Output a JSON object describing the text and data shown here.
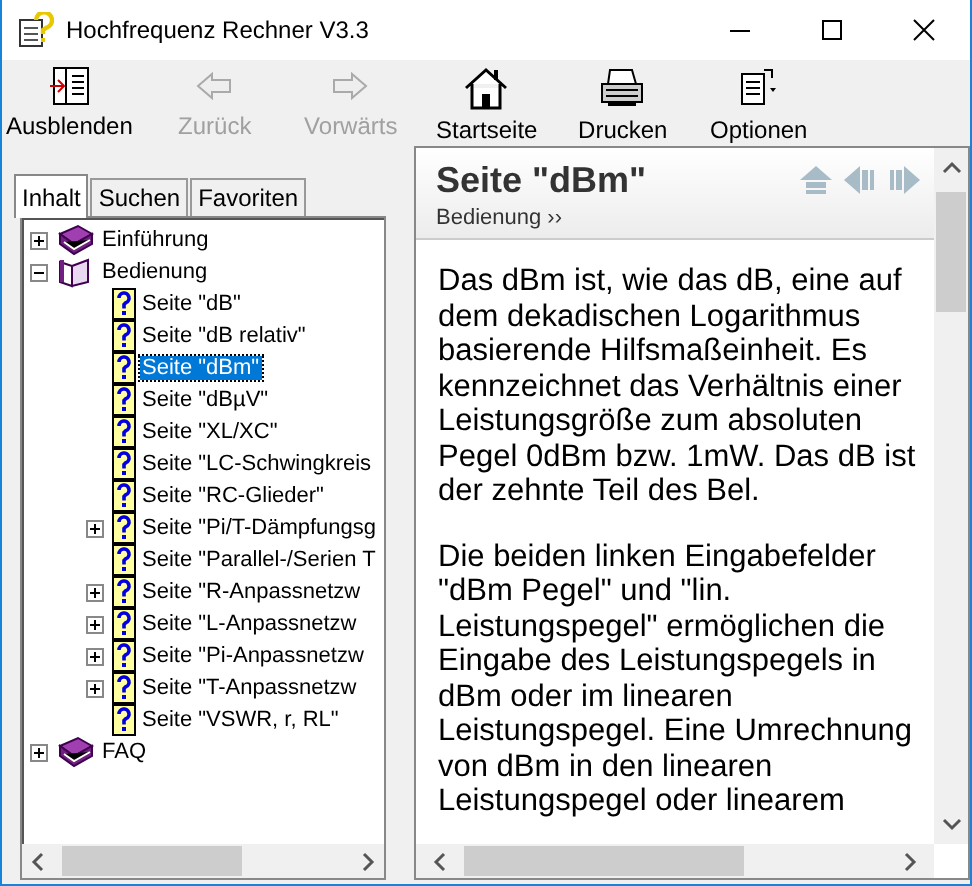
{
  "window": {
    "title": "Hochfrequenz Rechner V3.3"
  },
  "toolbar": [
    {
      "label": "Ausblenden",
      "kind": "hide",
      "disabled": false
    },
    {
      "label": "Zurück",
      "kind": "back",
      "disabled": true
    },
    {
      "label": "Vorwärts",
      "kind": "forward",
      "disabled": true
    },
    {
      "label": "Startseite",
      "kind": "home",
      "disabled": false
    },
    {
      "label": "Drucken",
      "kind": "print",
      "disabled": false
    },
    {
      "label": "Optionen",
      "kind": "options",
      "disabled": false
    }
  ],
  "tabs": [
    {
      "label": "Inhalt",
      "selected": true
    },
    {
      "label": "Suchen",
      "selected": false
    },
    {
      "label": "Favoriten",
      "selected": false
    }
  ],
  "tree": [
    {
      "label": "Einführung",
      "kind": "book",
      "expanded": false,
      "selected": false
    },
    {
      "label": "Bedienung",
      "kind": "book",
      "expanded": true,
      "selected": false,
      "children": [
        {
          "label": "Seite \"dB\"",
          "kind": "page",
          "selected": false
        },
        {
          "label": "Seite \"dB relativ\"",
          "kind": "page",
          "selected": false
        },
        {
          "label": "Seite \"dBm\"",
          "kind": "page",
          "selected": true
        },
        {
          "label": "Seite \"dBµV\"",
          "kind": "page",
          "selected": false
        },
        {
          "label": "Seite \"XL/XC\"",
          "kind": "page",
          "selected": false
        },
        {
          "label": "Seite \"LC-Schwingkreis",
          "kind": "page",
          "selected": false
        },
        {
          "label": "Seite \"RC-Glieder\"",
          "kind": "page",
          "selected": false
        },
        {
          "label": "Seite \"Pi/T-Dämpfungsg",
          "kind": "page",
          "expanded": false,
          "selected": false
        },
        {
          "label": "Seite \"Parallel-/Serien T",
          "kind": "page",
          "selected": false
        },
        {
          "label": "Seite \"R-Anpassnetzw",
          "kind": "page",
          "expanded": false,
          "selected": false
        },
        {
          "label": "Seite \"L-Anpassnetzw",
          "kind": "page",
          "expanded": false,
          "selected": false
        },
        {
          "label": "Seite \"Pi-Anpassnetzw",
          "kind": "page",
          "expanded": false,
          "selected": false
        },
        {
          "label": "Seite \"T-Anpassnetzw",
          "kind": "page",
          "expanded": false,
          "selected": false
        },
        {
          "label": "Seite \"VSWR, r, RL\"",
          "kind": "page",
          "selected": false
        }
      ]
    },
    {
      "label": "FAQ",
      "kind": "book",
      "expanded": false,
      "selected": false
    }
  ],
  "page": {
    "title": "Seite \"dBm\"",
    "breadcrumb": "Bedienung ››",
    "paragraphs": [
      "Das dBm ist, wie das dB, eine auf dem dekadischen Logarithmus basierende Hilfsmaßeinheit. Es kennzeichnet das Verhältnis einer Leistungsgröße zum absoluten Pegel 0dBm bzw. 1mW. Das dB ist der zehnte Teil des Bel.",
      "Die beiden linken Eingabefelder \"dBm Pegel\" und \"lin. Leistungspegel\" ermöglichen die Eingabe des Leistungspegels in dBm oder im linearen Leistungspegel. Eine Umrechnung von dBm in den linearen Leistungspegel oder linearem"
    ]
  }
}
